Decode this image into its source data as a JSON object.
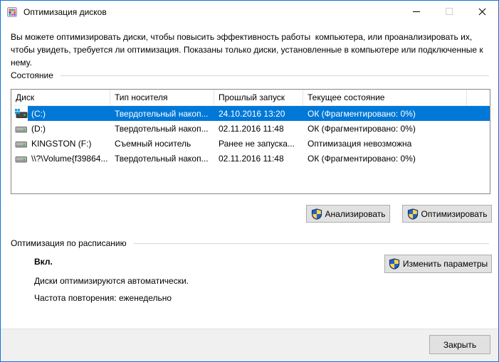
{
  "window": {
    "title": "Оптимизация дисков"
  },
  "description": "Вы можете оптимизировать диски, чтобы повысить эффективность работы  компьютера, или проанализировать их, чтобы увидеть, требуется ли оптимизация. Показаны только диски, установленные в компьютере или подключенные к нему.",
  "status_section": {
    "label": "Состояние"
  },
  "table": {
    "columns": [
      "Диск",
      "Тип носителя",
      "Прошлый запуск",
      "Текущее состояние"
    ],
    "rows": [
      {
        "drive": "(C:)",
        "media_type": "Твердотельный накоп...",
        "last_run": "24.10.2016 13:20",
        "current_status": "ОК (Фрагментировано: 0%)",
        "selected": true,
        "icon": "system-drive-icon"
      },
      {
        "drive": "(D:)",
        "media_type": "Твердотельный накоп...",
        "last_run": "02.11.2016 11:48",
        "current_status": "ОК (Фрагментировано: 0%)",
        "selected": false,
        "icon": "drive-icon"
      },
      {
        "drive": "KINGSTON (F:)",
        "media_type": "Съемный носитель",
        "last_run": "Ранее не запуска...",
        "current_status": "Оптимизация невозможна",
        "selected": false,
        "icon": "drive-icon"
      },
      {
        "drive": "\\\\?\\Volume{f39864...",
        "media_type": "Твердотельный накоп...",
        "last_run": "02.11.2016 11:48",
        "current_status": "ОК (Фрагментировано: 0%)",
        "selected": false,
        "icon": "drive-icon"
      }
    ]
  },
  "buttons": {
    "analyze": "Анализировать",
    "optimize": "Оптимизировать",
    "change_settings": "Изменить параметры",
    "close": "Закрыть"
  },
  "schedule_section": {
    "label": "Оптимизация по расписанию",
    "state": "Вкл.",
    "line1": "Диски оптимизируются автоматически.",
    "line2": "Частота повторения: еженедельно"
  },
  "colors": {
    "accent": "#0078d7",
    "selection": "#0078d7",
    "shield_blue": "#2660c9",
    "shield_yellow": "#f7d64a"
  }
}
